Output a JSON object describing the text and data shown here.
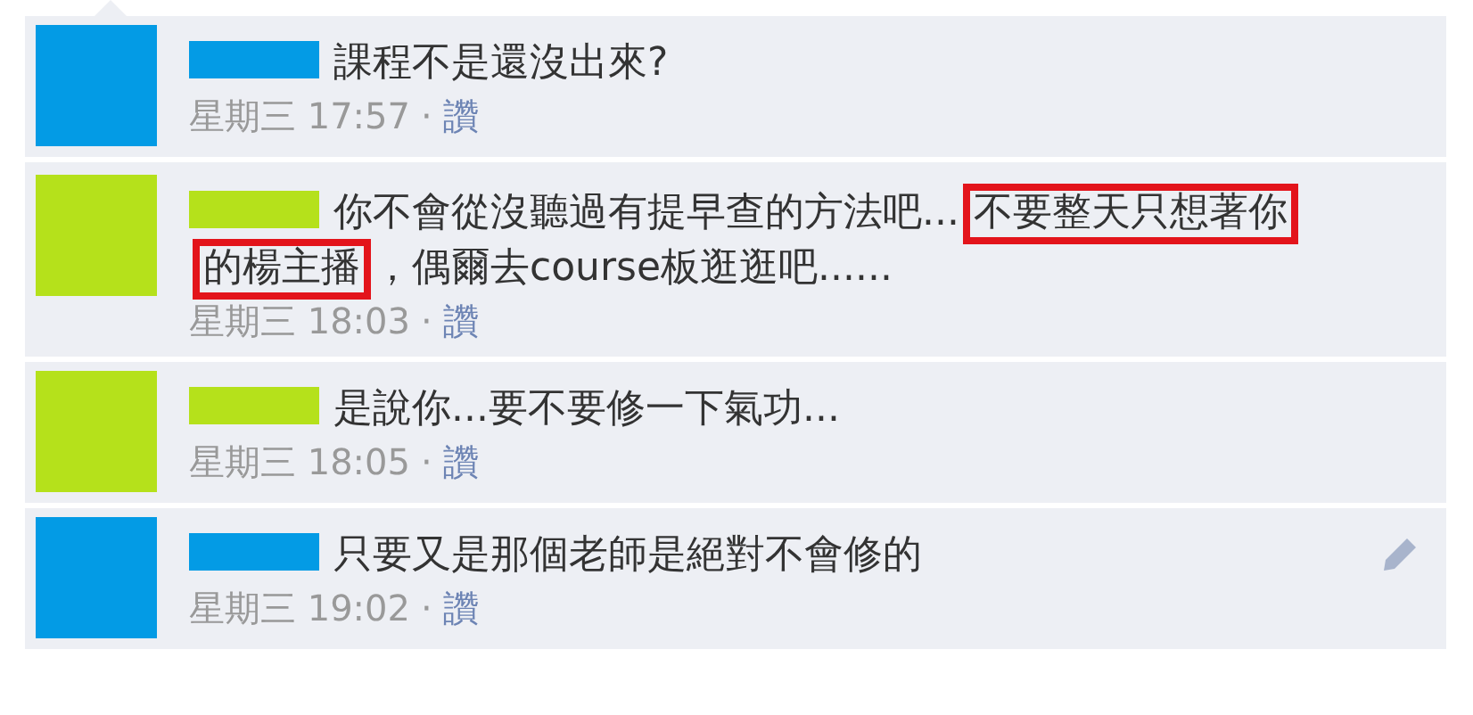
{
  "comments": [
    {
      "color": "#039be5",
      "segments": [
        {
          "text": "課程不是還沒出來?",
          "highlighted": false
        }
      ],
      "time": "星期三 17:57",
      "separator": "·",
      "like": "讚",
      "edit_icon": false
    },
    {
      "color": "#b5e11b",
      "segments": [
        {
          "text": "你不會從沒聽過有提早查的方法吧...",
          "highlighted": false
        },
        {
          "text": "不要整天只想著你",
          "highlighted": true
        },
        {
          "text": "的楊主播",
          "highlighted": true
        },
        {
          "text": "，偶爾去course板逛逛吧......",
          "highlighted": false
        }
      ],
      "time": "星期三 18:03",
      "separator": "·",
      "like": "讚",
      "edit_icon": false
    },
    {
      "color": "#b5e11b",
      "segments": [
        {
          "text": "是說你...要不要修一下氣功...",
          "highlighted": false
        }
      ],
      "time": "星期三 18:05",
      "separator": "·",
      "like": "讚",
      "edit_icon": false
    },
    {
      "color": "#039be5",
      "segments": [
        {
          "text": "只要又是那個老師是絕對不會修的",
          "highlighted": false
        }
      ],
      "time": "星期三 19:02",
      "separator": "·",
      "like": "讚",
      "edit_icon": true
    }
  ]
}
